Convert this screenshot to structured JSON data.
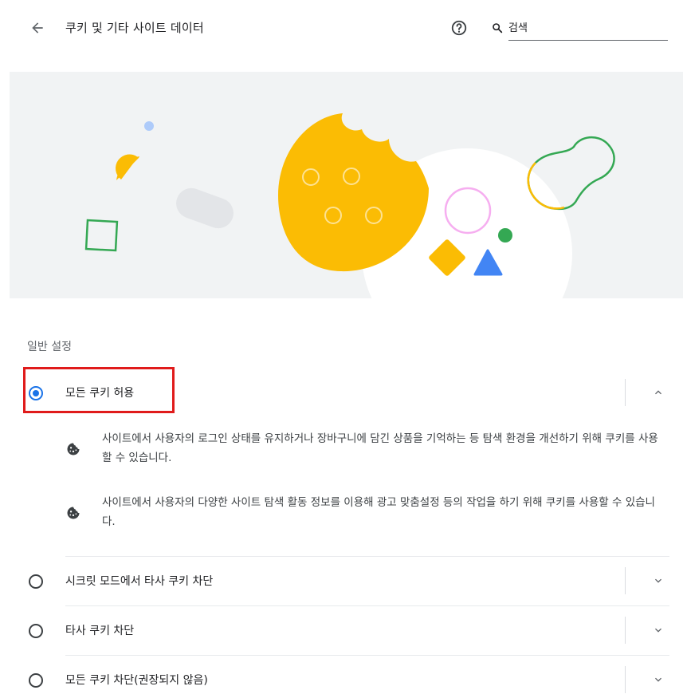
{
  "header": {
    "title": "쿠키 및 기타 사이트 데이터",
    "search_placeholder": "검색"
  },
  "section": {
    "title": "일반 설정"
  },
  "options": [
    {
      "label": "모든 쿠키 허용",
      "selected": true,
      "expanded": true,
      "details": [
        "사이트에서 사용자의 로그인 상태를 유지하거나 장바구니에 담긴 상품을 기억하는 등 탐색 환경을 개선하기 위해 쿠키를 사용할 수 있습니다.",
        "사이트에서 사용자의 다양한 사이트 탐색 활동 정보를 이용해 광고 맞춤설정 등의 작업을 하기 위해 쿠키를 사용할 수 있습니다."
      ]
    },
    {
      "label": "시크릿 모드에서 타사 쿠키 차단",
      "selected": false,
      "expanded": false
    },
    {
      "label": "타사 쿠키 차단",
      "selected": false,
      "expanded": false
    },
    {
      "label": "모든 쿠키 차단(권장되지 않음)",
      "selected": false,
      "expanded": false
    }
  ],
  "icons": {
    "back": "arrow-back-icon",
    "help": "help-circle-icon",
    "search": "search-icon",
    "cookie": "cookie-icon",
    "expand": "chevron-down-icon",
    "collapse": "chevron-up-icon"
  },
  "colors": {
    "accent": "#1a73e8",
    "highlight": "#e01b1b",
    "cookie_yellow": "#fbbc04",
    "banner_bg": "#f1f3f4"
  }
}
